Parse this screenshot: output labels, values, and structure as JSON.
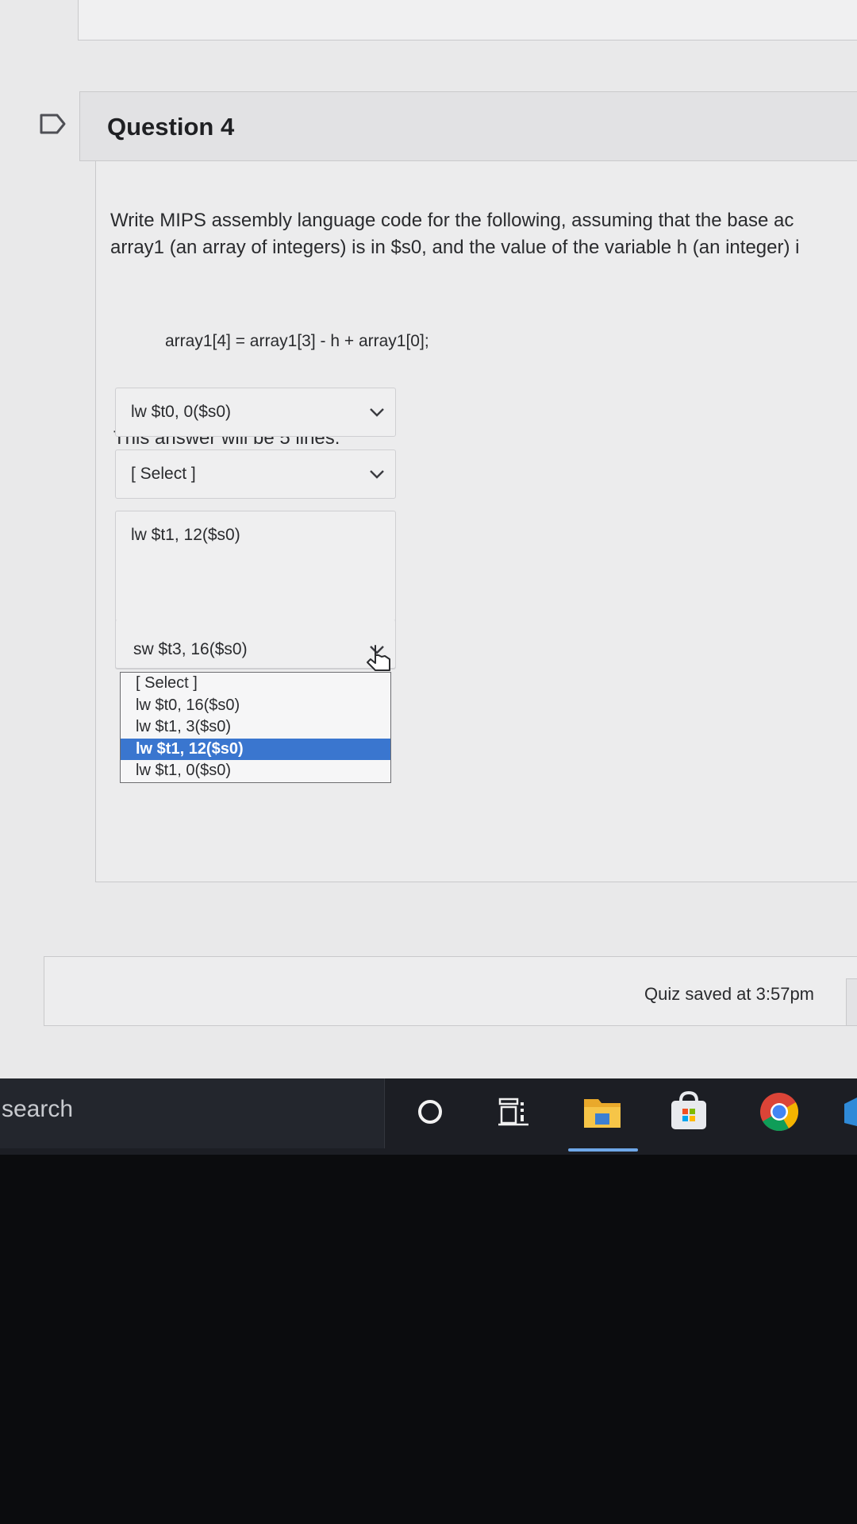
{
  "question": {
    "title": "Question 4",
    "prompt_lines": [
      "Write MIPS assembly language code for the following, assuming that the base ac",
      "array1 (an array of integers) is in $s0, and the value of the variable h (an integer) i"
    ],
    "code": "array1[4] = array1[3] - h + array1[0];",
    "answer_note": "This answer will be 5 lines:"
  },
  "dropdowns": [
    {
      "value": "lw $t0, 0($s0)"
    },
    {
      "value": "[ Select ]"
    },
    {
      "value": "lw $t1, 12($s0)"
    },
    {
      "value": "sw $t3, 16($s0)"
    }
  ],
  "open_dropdown": {
    "options": [
      "[ Select ]",
      "lw $t0, 16($s0)",
      "lw $t1, 3($s0)",
      "lw $t1, 12($s0)",
      "lw $t1, 0($s0)"
    ],
    "selected_option": "lw $t1, 12($s0)"
  },
  "footer": {
    "save_status": "Quiz saved at 3:57pm"
  },
  "taskbar": {
    "search_text": "search",
    "icons": [
      "cortana-circle-icon",
      "task-view-icon",
      "file-explorer-icon",
      "microsoft-store-icon",
      "chrome-icon"
    ]
  },
  "colors": {
    "selected_option_bg": "#3a76cf",
    "page_bg": "#e9e9ea",
    "taskbar_bg": "#1c1e24"
  }
}
